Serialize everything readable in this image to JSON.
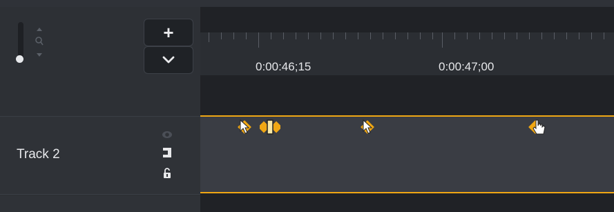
{
  "toolbar": {
    "add_label": "+",
    "expand_icon": "chevron-down-icon",
    "zoom_icon": "zoom-icon"
  },
  "ruler": {
    "time_labels": [
      "0:00:46;15",
      "0:00:47;00"
    ]
  },
  "track": {
    "name": "Track 2",
    "icons": [
      "eye-icon",
      "magnet-icon",
      "lock-icon"
    ]
  },
  "markers": {
    "icons": [
      "cursor-keyframe-icon",
      "split-keyframe-icon",
      "cursor-keyframe-icon",
      "hand-keyframe-icon"
    ]
  },
  "colors": {
    "accent": "#f0a714",
    "panel": "#2d3035",
    "timeline_bg": "#202226",
    "clip": "#3a3d44"
  }
}
